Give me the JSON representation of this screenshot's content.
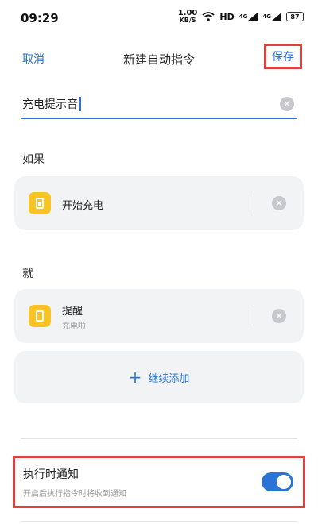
{
  "status_bar": {
    "time": "09:29",
    "net_speed_value": "1.00",
    "net_speed_unit": "KB/S",
    "wifi_icon": "wifi-icon",
    "hd_label": "HD",
    "signal1_label": "4G",
    "signal2_label": "4G",
    "battery_level": "87"
  },
  "header": {
    "cancel_label": "取消",
    "title": "新建自动指令",
    "save_label": "保存"
  },
  "name_input": {
    "value": "充电提示音"
  },
  "if_section": {
    "label": "如果",
    "trigger_title": "开始充电"
  },
  "then_section": {
    "label": "就",
    "action_title": "提醒",
    "action_subtitle": "充电啦",
    "add_label": "继续添加"
  },
  "notify": {
    "title": "执行时通知",
    "subtitle": "开启后执行指令时将收到通知",
    "enabled": true
  },
  "colors": {
    "accent": "#2a74d6",
    "highlight": "#e04040",
    "icon_yellow": "#f7c325"
  }
}
